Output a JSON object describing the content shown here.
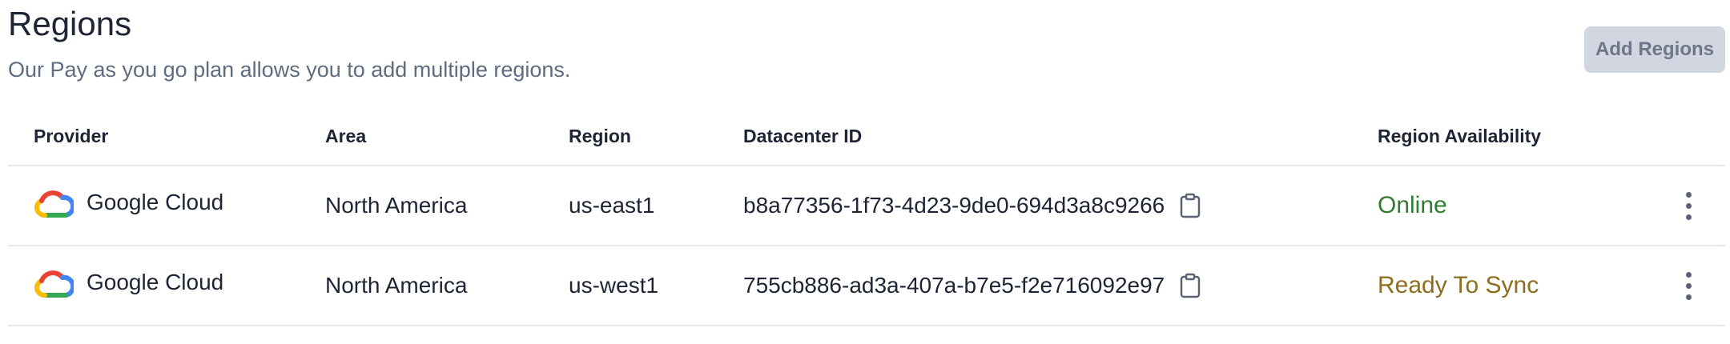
{
  "header": {
    "title": "Regions",
    "subtitle": "Our Pay as you go plan allows you to add multiple regions.",
    "add_button_label": "Add Regions"
  },
  "table": {
    "columns": [
      "Provider",
      "Area",
      "Region",
      "Datacenter ID",
      "Region Availability"
    ],
    "rows": [
      {
        "provider": "Google Cloud",
        "provider_icon": "google-cloud-icon",
        "area": "North America",
        "region": "us-east1",
        "datacenter_id": "b8a77356-1f73-4d23-9de0-694d3a8c9266",
        "availability": "Online",
        "availability_color": "#2e7d32"
      },
      {
        "provider": "Google Cloud",
        "provider_icon": "google-cloud-icon",
        "area": "North America",
        "region": "us-west1",
        "datacenter_id": "755cb886-ad3a-407a-b7e5-f2e716092e97",
        "availability": "Ready To Sync",
        "availability_color": "#8d6e1e"
      }
    ]
  },
  "icons": {
    "copy": "clipboard-icon",
    "row_menu": "kebab-menu-icon"
  },
  "colors": {
    "title": "#1e2433",
    "subtitle": "#5f6b7f",
    "button_bg": "#d1d6e0",
    "button_text": "#6e7687",
    "divider": "#e4e7ec",
    "google_blue": "#4285F4",
    "google_red": "#EA4335",
    "google_yellow": "#FBBC05",
    "google_green": "#34A853"
  }
}
